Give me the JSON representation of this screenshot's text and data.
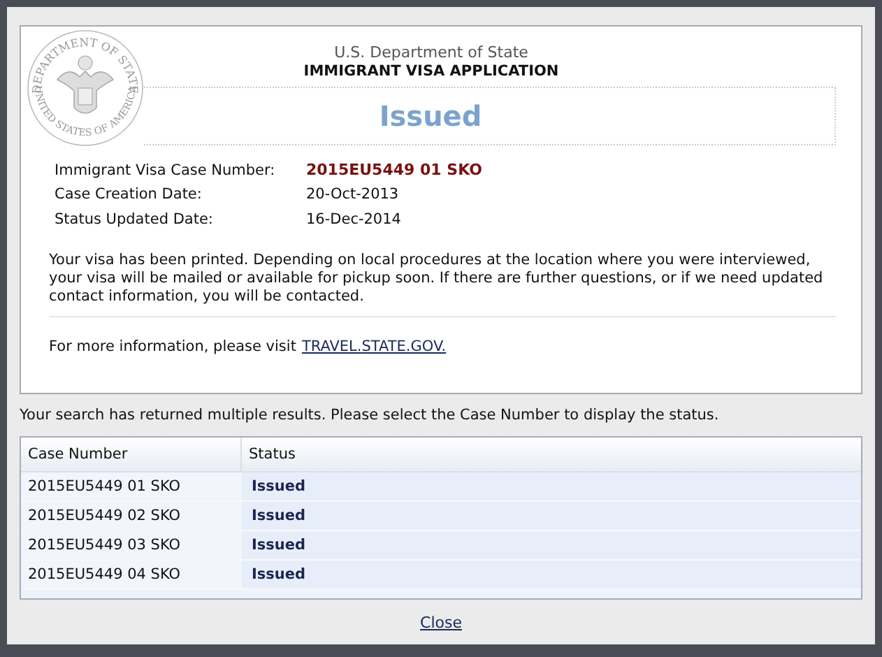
{
  "seal": {
    "top_text": "DEPARTMENT OF STATE",
    "bottom_text": "UNITED STATES OF AMERICA"
  },
  "header": {
    "department": "U.S. Department of State",
    "title": "IMMIGRANT VISA APPLICATION"
  },
  "status_title": "Issued",
  "details": [
    {
      "label": "Immigrant Visa Case Number:",
      "value": "2015EU5449 01 SKO",
      "kind": "case"
    },
    {
      "label": "Case Creation Date:",
      "value": "20-Oct-2013",
      "kind": "plain"
    },
    {
      "label": "Status Updated Date:",
      "value": "16-Dec-2014",
      "kind": "plain"
    }
  ],
  "message": "Your visa has been printed. Depending on local procedures at the location where you were interviewed, your visa will be mailed or available for pickup soon. If there are further questions, or if we need updated contact information, you will be contacted.",
  "more_info": {
    "text": "For more information, please visit",
    "link": "TRAVEL.STATE.GOV."
  },
  "results_note": "Your search has returned multiple results. Please select the Case Number to display the status.",
  "table": {
    "columns": [
      "Case Number",
      "Status"
    ],
    "rows": [
      [
        "2015EU5449 01 SKO",
        "Issued"
      ],
      [
        "2015EU5449 02 SKO",
        "Issued"
      ],
      [
        "2015EU5449 03 SKO",
        "Issued"
      ],
      [
        "2015EU5449 04 SKO",
        "Issued"
      ]
    ]
  },
  "close": "Close"
}
